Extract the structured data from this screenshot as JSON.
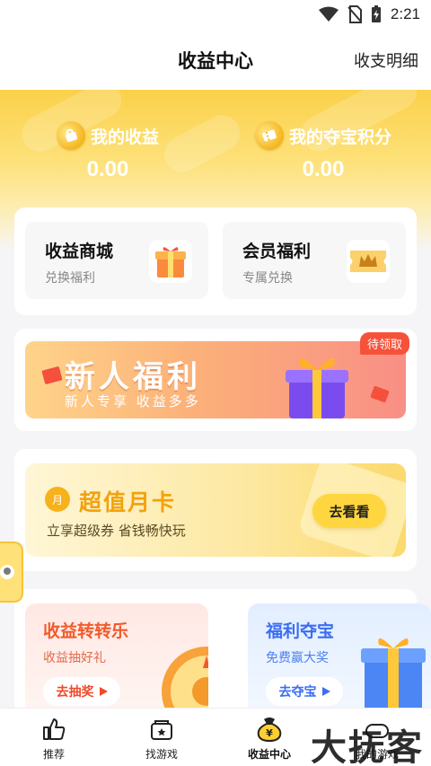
{
  "status_bar": {
    "time": "2:21"
  },
  "header": {
    "title": "收益中心",
    "detail_link": "收支明细"
  },
  "earnings": [
    {
      "label": "我的收益",
      "value": "0.00"
    },
    {
      "label": "我的夺宝积分",
      "value": "0.00"
    }
  ],
  "mall": [
    {
      "title": "收益商城",
      "subtitle": "兑换福利"
    },
    {
      "title": "会员福利",
      "subtitle": "专属兑换"
    }
  ],
  "newcomer": {
    "title": "新人福利",
    "subtitle": "新人专享  收益多多",
    "tag": "待领取"
  },
  "monthly_card": {
    "badge": "月",
    "title": "超值月卡",
    "subtitle": "立享超级券 省钱畅快玩",
    "button": "去看看"
  },
  "games": [
    {
      "title": "收益转转乐",
      "subtitle": "收益抽好礼",
      "button": "去抽奖"
    },
    {
      "title": "福利夺宝",
      "subtitle": "免费赢大奖",
      "button": "去夺宝"
    }
  ],
  "bottom_nav": [
    {
      "label": "推荐"
    },
    {
      "label": "找游戏"
    },
    {
      "label": "收益中心"
    },
    {
      "label": "我的游戏"
    }
  ],
  "watermark": "大抚客",
  "colors": {
    "accent_yellow": "#fbd14a",
    "spin_red": "#f25a2a",
    "treasure_blue": "#3b6ef0"
  }
}
